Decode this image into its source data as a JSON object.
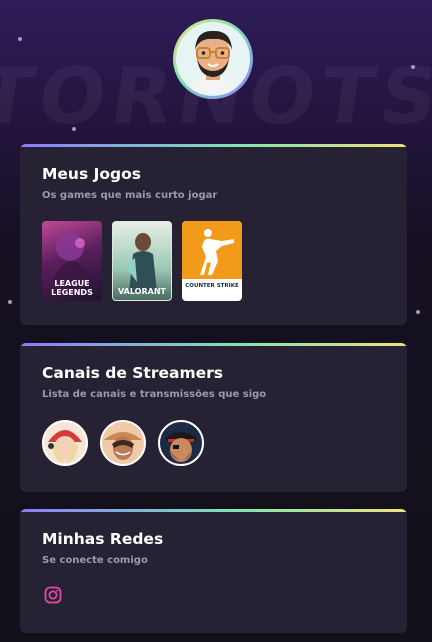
{
  "background": {
    "watermark": "TORNOTS"
  },
  "profile": {
    "avatar_icon": "memoji-avatar-icon"
  },
  "games_card": {
    "title": "Meus Jogos",
    "subtitle": "Os games que mais curto jogar",
    "games": [
      {
        "name": "League of Legends",
        "label_line1": "LEAGUE",
        "label_line2": "LEGENDS",
        "accent": "#7a2a6e"
      },
      {
        "name": "Valorant",
        "label": "VALORANT",
        "accent": "#9ac7b2"
      },
      {
        "name": "Counter Strike",
        "label": "COUNTER STRIKE",
        "accent": "#f29a1a"
      }
    ]
  },
  "streamers_card": {
    "title": "Canais de Streamers",
    "subtitle": "Lista de canais e transmissões que sigo",
    "streamers": [
      {
        "icon": "streamer-1-avatar-icon"
      },
      {
        "icon": "streamer-2-avatar-icon"
      },
      {
        "icon": "streamer-3-avatar-icon"
      }
    ]
  },
  "social_card": {
    "title": "Minhas Redes",
    "subtitle": "Se conecte comigo",
    "links": [
      {
        "icon": "instagram-icon",
        "color": "#e24aa8"
      }
    ]
  }
}
